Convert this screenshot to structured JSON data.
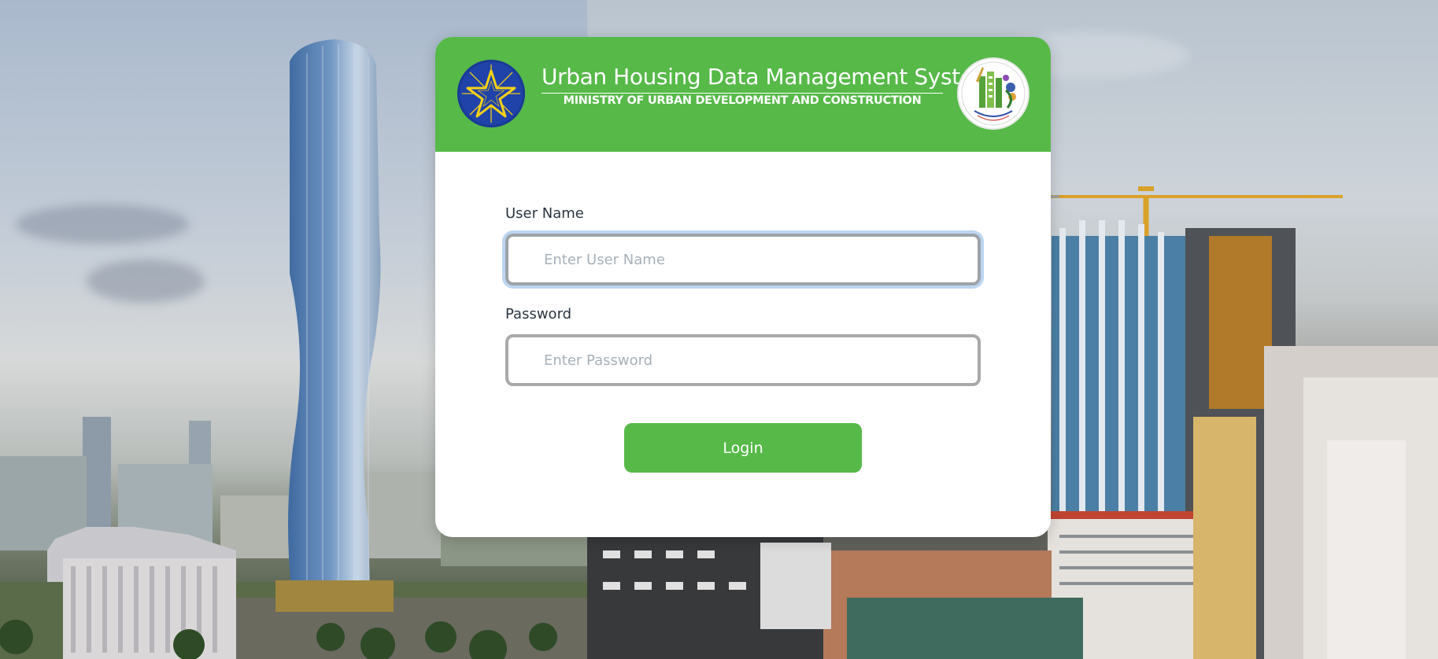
{
  "header": {
    "title": "Urban Housing Data Management System",
    "subtitle": "MINISTRY OF URBAN DEVELOPMENT AND CONSTRUCTION",
    "left_emblem": "ethiopia-national-emblem-icon",
    "right_emblem": "ministry-logo-icon"
  },
  "form": {
    "username": {
      "label": "User Name",
      "placeholder": "Enter User Name",
      "value": ""
    },
    "password": {
      "label": "Password",
      "placeholder": "Enter Password",
      "value": ""
    },
    "login_label": "Login"
  },
  "colors": {
    "brand_green": "#56b948",
    "emblem_blue": "#1f43a8",
    "emblem_gold": "#f7d117"
  }
}
